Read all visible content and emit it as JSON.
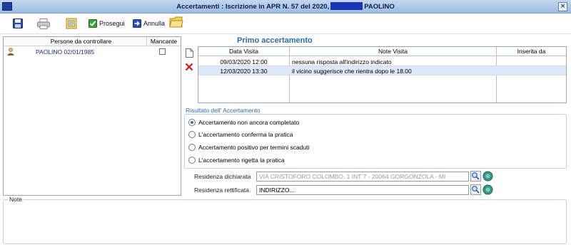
{
  "window": {
    "title_part1": "Accertamenti : Iscrizione in APR N. 57 del 2020,",
    "title_part2": "PAOLINO",
    "close_glyph": "×"
  },
  "toolbar": {
    "save_icon": "floppy-disk-icon",
    "print_icon": "printer-icon",
    "clipboard_icon": "clipboard-icon",
    "prosegui_label": "Prosegui",
    "annulla_label": "Annulla",
    "folder_icon": "folder-icon"
  },
  "persons": {
    "col_person": "Persone da controllare",
    "col_missing": "Mancante",
    "rows": [
      {
        "name": "PAOLINO 02/01/1985",
        "missing": false
      }
    ]
  },
  "section_title": "Primo accertamento",
  "visits": {
    "col_date": "Data Visita",
    "col_notes": "Note Visita",
    "col_inserted": "Inserita da",
    "rows": [
      {
        "date": "09/03/2020 12:00",
        "notes": "nessuna risposta all'indirizzo indicato",
        "inserted": ""
      },
      {
        "date": "12/03/2020 13:30",
        "notes": "il vicino suggerisce che rientra dopo le 18.00",
        "inserted": ""
      }
    ]
  },
  "result": {
    "label": "Risultato dell' Accertamento",
    "options": [
      {
        "label": "Accertamento non ancora completato",
        "selected": true
      },
      {
        "label": "L'accertamento conferma la pratica",
        "selected": false
      },
      {
        "label": "Accertamento positivo per termini scaduti",
        "selected": false
      },
      {
        "label": "L'accertamento rigetta la pratica",
        "selected": false
      }
    ]
  },
  "residence": {
    "declared_label": "Residenza dichiarata",
    "declared_value": "VIA CRISTOFORO COLOMBO, 1 INT 7 - 20064 GORGONZOLA - MI",
    "corrected_label": "Residenza rettificata",
    "corrected_value": "INDIRIZZO..."
  },
  "notes": {
    "label": "Note"
  },
  "colors": {
    "title_bg": "#b5cdea",
    "accent": "#2f6aa8",
    "selection": "#dde9f8"
  }
}
